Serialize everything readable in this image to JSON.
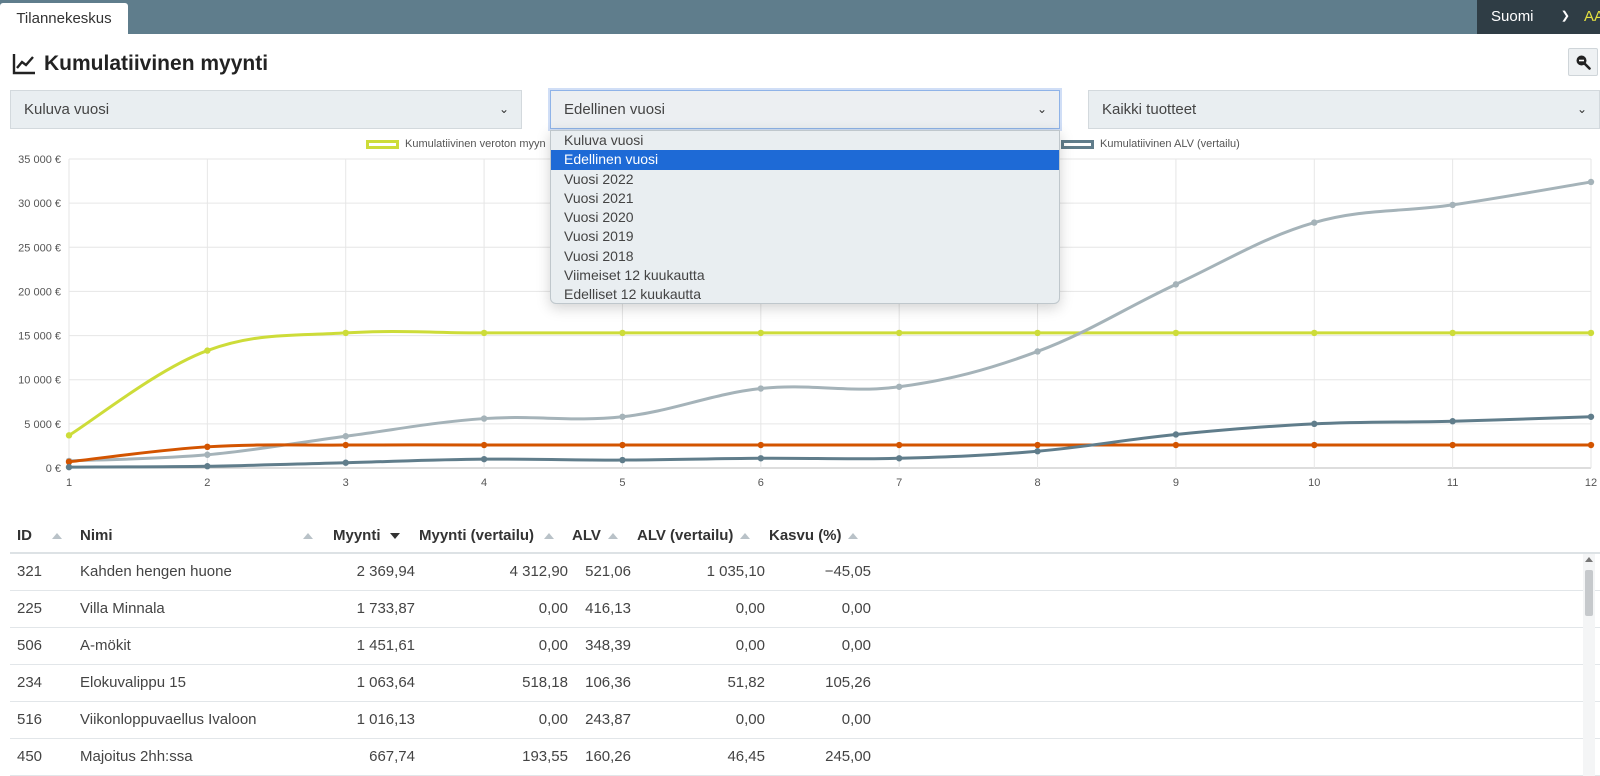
{
  "topbar": {
    "tab_label": "Tilannekeskus",
    "language": "Suomi",
    "user_initials": "AA"
  },
  "page": {
    "title": "Kumulatiivinen myynti"
  },
  "filters": {
    "period": "Kuluva vuosi",
    "comparison": "Edellinen vuosi",
    "products": "Kaikki tuotteet"
  },
  "dropdown": {
    "options": [
      "Kuluva vuosi",
      "Edellinen vuosi",
      "Vuosi 2022",
      "Vuosi 2021",
      "Vuosi 2020",
      "Vuosi 2019",
      "Vuosi 2018",
      "Viimeiset 12 kuukautta",
      "Edelliset 12 kuukautta"
    ],
    "selected_index": 1
  },
  "chart_data": {
    "type": "line",
    "x": [
      1,
      2,
      3,
      4,
      5,
      6,
      7,
      8,
      9,
      10,
      11,
      12
    ],
    "ylim": [
      0,
      35000
    ],
    "yticks": [
      0,
      5000,
      10000,
      15000,
      20000,
      25000,
      30000,
      35000
    ],
    "ytick_labels": [
      "0 €",
      "5 000 €",
      "10 000 €",
      "15 000 €",
      "20 000 €",
      "25 000 €",
      "30 000 €",
      "35 000 €"
    ],
    "xtick_labels": [
      "1",
      "2",
      "3",
      "4",
      "5",
      "6",
      "7",
      "8",
      "9",
      "10",
      "11",
      "12"
    ],
    "grid": true,
    "legend": {
      "placement": "top",
      "visible_labels": [
        "Kumulatiivinen veroton myyn",
        "Kumulatiivinen ALV (vertailu)"
      ]
    },
    "series": [
      {
        "name": "Kumulatiivinen veroton myyn",
        "color": "#cddc39",
        "values": [
          3700,
          13300,
          15300,
          15300,
          15300,
          15300,
          15300,
          15300,
          15300,
          15300,
          15300,
          15300
        ]
      },
      {
        "color": "#a5b3b9",
        "values": [
          800,
          1500,
          3600,
          5600,
          5800,
          9000,
          9200,
          13200,
          20800,
          27800,
          29800,
          32400
        ]
      },
      {
        "color": "#d35400",
        "values": [
          700,
          2400,
          2600,
          2600,
          2600,
          2600,
          2600,
          2600,
          2600,
          2600,
          2600,
          2600
        ]
      },
      {
        "name": "Kumulatiivinen ALV (vertailu)",
        "color": "#607d8b",
        "values": [
          100,
          200,
          600,
          1000,
          900,
          1100,
          1100,
          1900,
          3800,
          5000,
          5300,
          5800
        ]
      }
    ]
  },
  "table": {
    "headers": [
      "ID",
      "Nimi",
      "Myynti",
      "Myynti (vertailu)",
      "ALV",
      "ALV (vertailu)",
      "Kasvu (%)"
    ],
    "rows": [
      [
        "321",
        "Kahden hengen huone",
        "2 369,94",
        "4 312,90",
        "521,06",
        "1 035,10",
        "−45,05"
      ],
      [
        "225",
        "Villa Minnala",
        "1 733,87",
        "0,00",
        "416,13",
        "0,00",
        "0,00"
      ],
      [
        "506",
        "A-mökit",
        "1 451,61",
        "0,00",
        "348,39",
        "0,00",
        "0,00"
      ],
      [
        "234",
        "Elokuvalippu 15",
        "1 063,64",
        "518,18",
        "106,36",
        "51,82",
        "105,26"
      ],
      [
        "516",
        "Viikonloppuvaellus Ivaloon",
        "1 016,13",
        "0,00",
        "243,87",
        "0,00",
        "0,00"
      ],
      [
        "450",
        "Majoitus 2hh:ssa",
        "667,74",
        "193,55",
        "160,26",
        "46,45",
        "245,00"
      ]
    ]
  }
}
